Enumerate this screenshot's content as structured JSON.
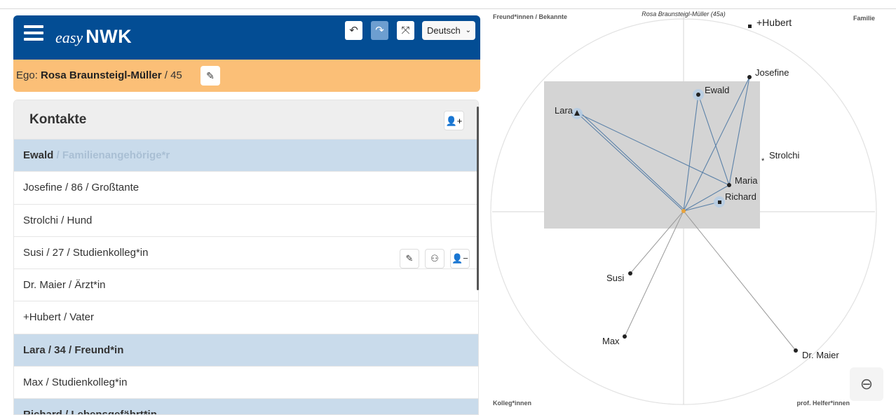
{
  "header": {
    "brand_easy": "easy",
    "brand_nwk": "NWK",
    "language": "Deutsch"
  },
  "ego": {
    "prefix": "Ego:",
    "name": "Rosa Braunsteigl-Müller",
    "age": "/ 45"
  },
  "contacts": {
    "title": "Kontakte",
    "rows": [
      {
        "name": "Ewald",
        "cat": " / Familienangehörige*r",
        "highlight": true
      },
      {
        "name": "Josefine / 86 / Großtante"
      },
      {
        "name": "Strolchi / Hund"
      },
      {
        "name": "Susi / 27 / Studienkolleg*in"
      },
      {
        "name": "Dr. Maier / Ärzt*in"
      },
      {
        "name": "+Hubert / Vater"
      },
      {
        "name": "Lara / 34 / Freund*in",
        "highlight": true
      },
      {
        "name": "Max / Studienkolleg*in"
      },
      {
        "name": "Richard / Lebensgefährt*in",
        "highlight": true
      }
    ]
  },
  "map": {
    "ego_label": "Rosa Braunsteigl-Müller (45a)",
    "quadrants": {
      "top_left": "Freund*innen / Bekannte",
      "top_right": "Familie",
      "bottom_left": "Kolleg*innen",
      "bottom_right": "prof. Helfer*innen"
    },
    "nodes": {
      "hubert": "+Hubert",
      "josefine": "Josefine",
      "ewald": "Ewald",
      "lara": "Lara",
      "strolchi": "Strolchi",
      "maria": "Maria",
      "richard": "Richard",
      "susi": "Susi",
      "max": "Max",
      "maier": "Dr. Maier"
    },
    "colors": {
      "edge_blue": "#5b81a8",
      "edge_gray": "#9a9a9a",
      "ego_dot": "#e8a33c",
      "selection": "#d4d4d4"
    }
  }
}
